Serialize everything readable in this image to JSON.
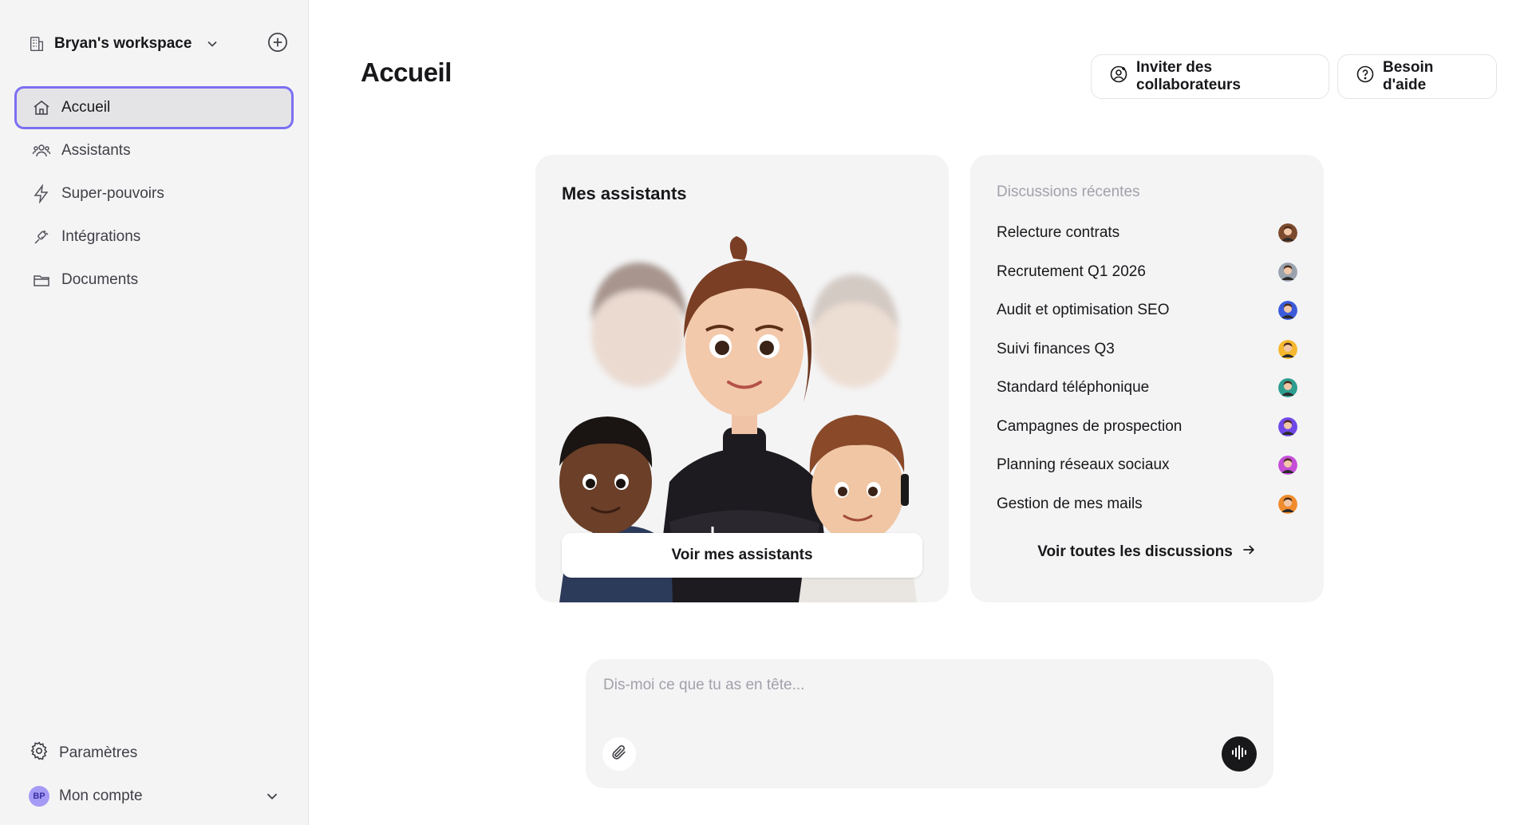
{
  "sidebar": {
    "workspace": {
      "name": "Bryan's workspace",
      "icon": "building-icon"
    },
    "items": [
      {
        "label": "Accueil",
        "icon": "home-icon",
        "active": true
      },
      {
        "label": "Assistants",
        "icon": "users-icon",
        "active": false
      },
      {
        "label": "Super-pouvoirs",
        "icon": "lightning-icon",
        "active": false
      },
      {
        "label": "Intégrations",
        "icon": "plug-icon",
        "active": false
      },
      {
        "label": "Documents",
        "icon": "folder-icon",
        "active": false
      }
    ],
    "settings_label": "Paramètres",
    "account": {
      "label": "Mon compte",
      "initials": "BP"
    }
  },
  "header": {
    "title": "Accueil",
    "invite_label": "Inviter des collaborateurs",
    "help_label": "Besoin d'aide"
  },
  "assistants_card": {
    "title": "Mes assistants",
    "button_label": "Voir mes assistants"
  },
  "discussions": {
    "title": "Discussions récentes",
    "items": [
      {
        "label": "Relecture contrats",
        "avatar_color": "#7c4a2d"
      },
      {
        "label": "Recrutement Q1 2026",
        "avatar_color": "#9aa3ad"
      },
      {
        "label": "Audit et optimisation SEO",
        "avatar_color": "#3b5bdb"
      },
      {
        "label": "Suivi finances Q3",
        "avatar_color": "#f5b82e"
      },
      {
        "label": "Standard téléphonique",
        "avatar_color": "#2f9e8f"
      },
      {
        "label": "Campagnes de prospection",
        "avatar_color": "#7048e8"
      },
      {
        "label": "Planning réseaux sociaux",
        "avatar_color": "#c44fd6"
      },
      {
        "label": "Gestion de mes mails",
        "avatar_color": "#f08c2e"
      }
    ],
    "see_all_label": "Voir toutes les discussions"
  },
  "composer": {
    "placeholder": "Dis-moi ce que tu as en tête...",
    "value": ""
  },
  "colors": {
    "accent": "#7c6ff2",
    "sidebar_bg": "#f4f4f5",
    "card_bg": "#f4f4f5"
  }
}
